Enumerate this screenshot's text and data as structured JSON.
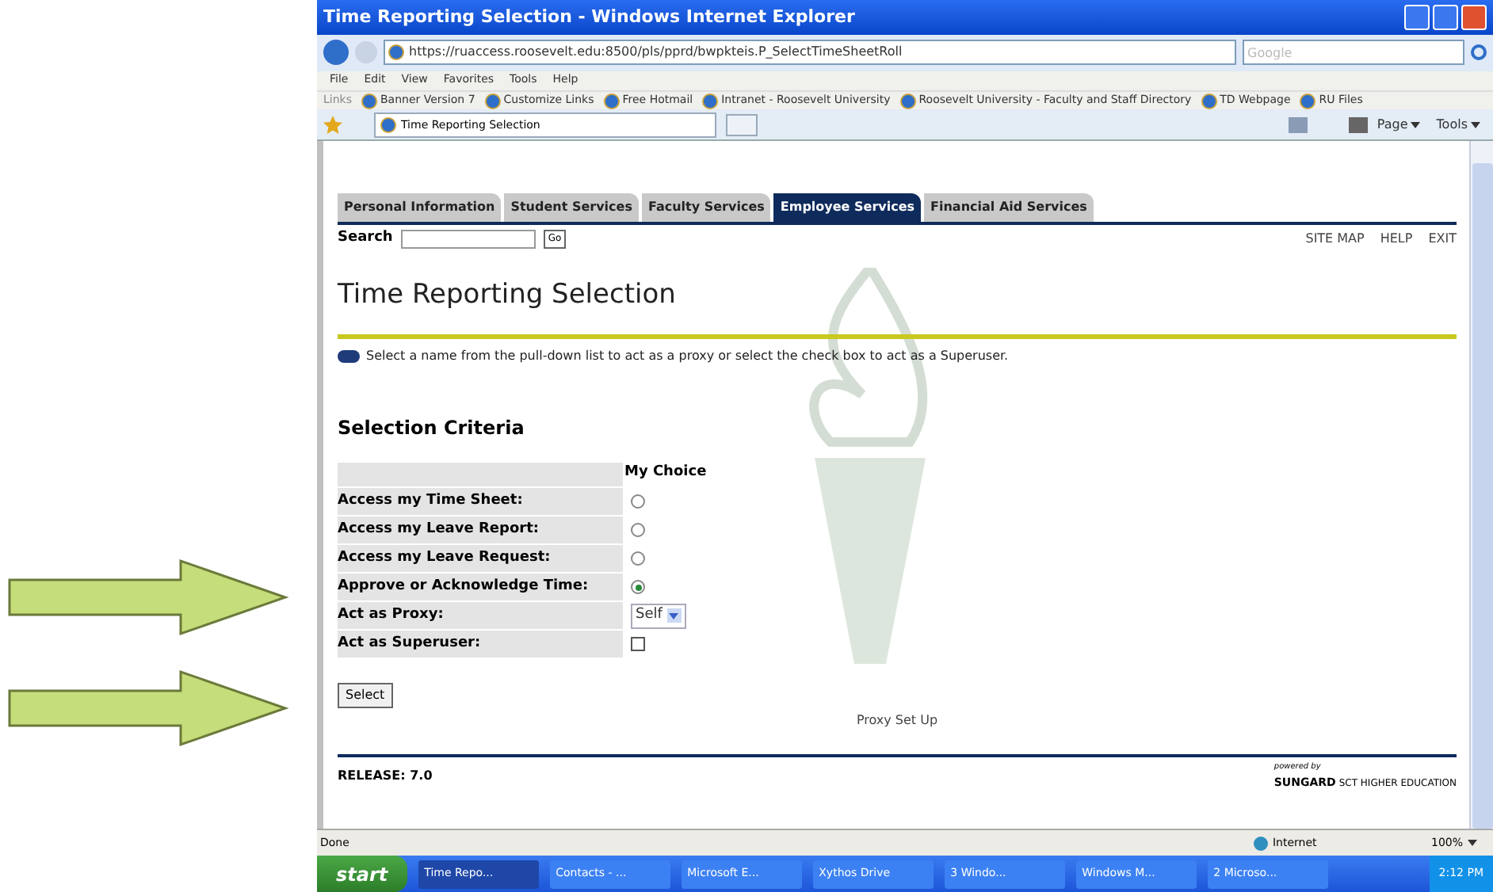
{
  "window": {
    "title": "Time Reporting Selection - Windows Internet Explorer"
  },
  "address": {
    "url": "https://ruaccess.roosevelt.edu:8500/pls/pprd/bwpkteis.P_SelectTimeSheetRoll",
    "search_placeholder": "Google"
  },
  "menu": [
    "File",
    "Edit",
    "View",
    "Favorites",
    "Tools",
    "Help"
  ],
  "links": {
    "label": "Links",
    "items": [
      "Banner Version 7",
      "Customize Links",
      "Free Hotmail",
      "Intranet - Roosevelt University",
      "Roosevelt University - Faculty and Staff Directory",
      "TD Webpage",
      "RU Files"
    ]
  },
  "browser_tab": {
    "label": "Time Reporting Selection"
  },
  "command_bar": [
    "Page",
    "Tools"
  ],
  "page": {
    "tabs": [
      {
        "label": "Personal Information",
        "selected": false
      },
      {
        "label": "Student Services",
        "selected": false
      },
      {
        "label": "Faculty Services",
        "selected": false
      },
      {
        "label": "Employee Services",
        "selected": true
      },
      {
        "label": "Financial Aid Services",
        "selected": false
      }
    ],
    "search_label": "Search",
    "go": "Go",
    "top_links": [
      "SITE MAP",
      "HELP",
      "EXIT"
    ],
    "heading": "Time Reporting Selection",
    "info": "Select a name from the pull-down list to act as a proxy or select the check box to act as a Superuser.",
    "section": "Selection Criteria",
    "column": "My Choice",
    "rows": [
      {
        "label": "Access my Time Sheet:",
        "kind": "radio",
        "selected": false
      },
      {
        "label": "Access my Leave Report:",
        "kind": "radio",
        "selected": false
      },
      {
        "label": "Access my Leave Request:",
        "kind": "radio",
        "selected": false
      },
      {
        "label": "Approve or Acknowledge Time:",
        "kind": "radio",
        "selected": true
      },
      {
        "label": "Act as Proxy:",
        "kind": "select",
        "value": "Self"
      },
      {
        "label": "Act as Superuser:",
        "kind": "checkbox",
        "checked": false
      }
    ],
    "button": "Select",
    "footer_link": "Proxy Set Up",
    "release": "RELEASE: 7.0",
    "powered_by": "powered by",
    "brand": "SUNGARD",
    "brand_rest": "SCT HIGHER EDUCATION"
  },
  "status_bar": {
    "text": "Done",
    "zone": "Internet",
    "zoom": "100%"
  },
  "taskbar": {
    "start": "start",
    "items": [
      {
        "label": "Time Repo...",
        "selected": true
      },
      {
        "label": "Contacts - ...",
        "selected": false
      },
      {
        "label": "Microsoft E...",
        "selected": false
      },
      {
        "label": "Xythos Drive",
        "selected": false
      },
      {
        "label": "3 Windo...",
        "selected": false
      },
      {
        "label": "Windows M...",
        "selected": false
      },
      {
        "label": "2 Microso...",
        "selected": false
      }
    ],
    "clock": "2:12 PM"
  }
}
